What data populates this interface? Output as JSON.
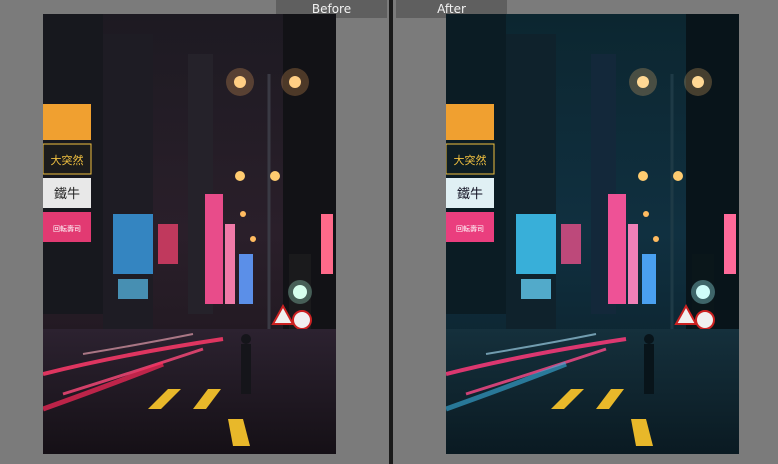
{
  "compare_view": {
    "before_label": "Before",
    "after_label": "After"
  },
  "photo": {
    "signs": {
      "chinese_top": "大突然",
      "chinese_mid": "鐵牛",
      "chinese_pink": "回転壽司"
    }
  },
  "colors": {
    "background": "#7b7b7b",
    "divider": "#1a1a1a",
    "label_bg": "#5f5f5f",
    "label_text": "#f2f2f2",
    "before_tint": "#2a1e2a",
    "after_tint": "#0e2a38"
  }
}
